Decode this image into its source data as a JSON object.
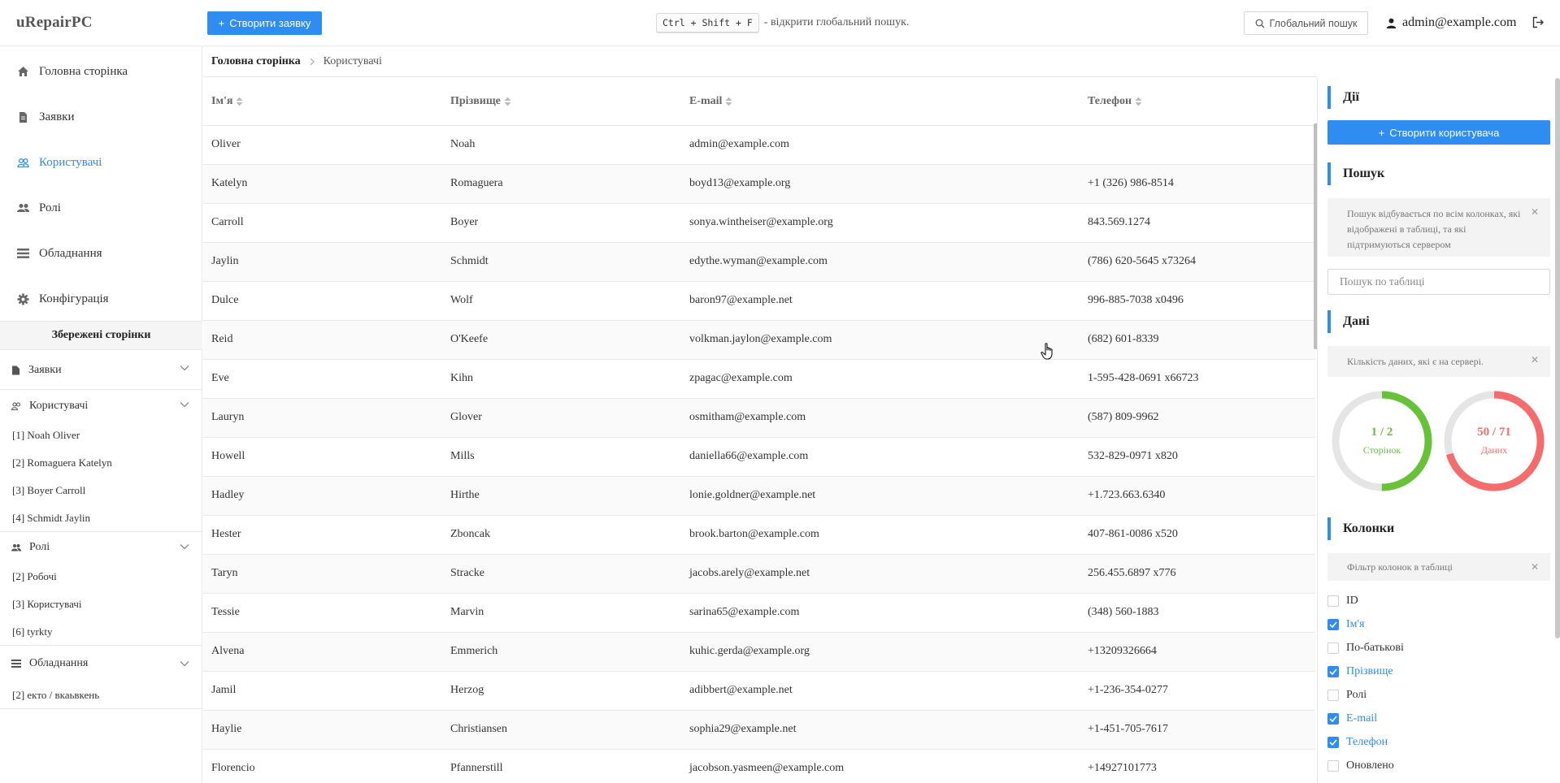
{
  "header": {
    "logo": "uRepairPC",
    "create_request_label": "Створити заявку",
    "shortcut_keys": "Ctrl + Shift + F",
    "shortcut_text": "- відкрити глобальний пошук.",
    "global_search_label": "Глобальний пошук",
    "user_email": "admin@example.com"
  },
  "nav": [
    {
      "label": "Головна сторінка",
      "icon": "home-icon"
    },
    {
      "label": "Заявки",
      "icon": "document-icon"
    },
    {
      "label": "Користувачі",
      "icon": "users-icon",
      "active": true
    },
    {
      "label": "Ролі",
      "icon": "roles-icon"
    },
    {
      "label": "Обладнання",
      "icon": "list-icon"
    },
    {
      "label": "Конфігурація",
      "icon": "gear-icon"
    }
  ],
  "saved": {
    "title": "Збережені сторінки",
    "groups": [
      {
        "label": "Заявки",
        "links": []
      },
      {
        "label": "Користувачі",
        "links": [
          "[1] Noah Oliver",
          "[2] Romaguera Katelyn",
          "[3] Boyer Carroll",
          "[4] Schmidt Jaylin"
        ]
      },
      {
        "label": "Ролі",
        "links": [
          "[2] Робочі",
          "[3] Користувачі",
          "[6] tyrkty"
        ]
      },
      {
        "label": "Обладнання",
        "links": [
          "[2] екто / вкаьвкень"
        ]
      }
    ]
  },
  "breadcrumb": {
    "home": "Головна сторінка",
    "current": "Користувачі"
  },
  "table": {
    "columns": [
      "Ім'я",
      "Прізвище",
      "E-mail",
      "Телефон"
    ],
    "rows": [
      [
        "Oliver",
        "Noah",
        "admin@example.com",
        ""
      ],
      [
        "Katelyn",
        "Romaguera",
        "boyd13@example.org",
        "+1 (326) 986-8514"
      ],
      [
        "Carroll",
        "Boyer",
        "sonya.wintheiser@example.org",
        "843.569.1274"
      ],
      [
        "Jaylin",
        "Schmidt",
        "edythe.wyman@example.com",
        "(786) 620-5645 x73264"
      ],
      [
        "Dulce",
        "Wolf",
        "baron97@example.net",
        "996-885-7038 x0496"
      ],
      [
        "Reid",
        "O'Keefe",
        "volkman.jaylon@example.com",
        "(682) 601-8339"
      ],
      [
        "Eve",
        "Kihn",
        "zpagac@example.com",
        "1-595-428-0691 x66723"
      ],
      [
        "Lauryn",
        "Glover",
        "osmitham@example.com",
        "(587) 809-9962"
      ],
      [
        "Howell",
        "Mills",
        "daniella66@example.com",
        "532-829-0971 x820"
      ],
      [
        "Hadley",
        "Hirthe",
        "lonie.goldner@example.net",
        "+1.723.663.6340"
      ],
      [
        "Hester",
        "Zboncak",
        "brook.barton@example.com",
        "407-861-0086 x520"
      ],
      [
        "Taryn",
        "Stracke",
        "jacobs.arely@example.net",
        "256.455.6897 x776"
      ],
      [
        "Tessie",
        "Marvin",
        "sarina65@example.com",
        "(348) 560-1883"
      ],
      [
        "Alvena",
        "Emmerich",
        "kuhic.gerda@example.org",
        "+13209326664"
      ],
      [
        "Jamil",
        "Herzog",
        "adibbert@example.net",
        "+1-236-354-0277"
      ],
      [
        "Haylie",
        "Christiansen",
        "sophia29@example.net",
        "+1-451-705-7617"
      ],
      [
        "Florencio",
        "Pfannerstill",
        "jacobson.yasmeen@example.com",
        "+14927101773"
      ]
    ]
  },
  "panel": {
    "actions_title": "Дії",
    "create_user_label": "Створити користувача",
    "search_title": "Пошук",
    "search_note": "Пошук відбувається по всім колонках, які відображені в таблиці, та які підтримуються сервером",
    "search_placeholder": "Пошук по таблиці",
    "data_title": "Дані",
    "data_note": "Кількість даних, які є на сервері.",
    "pages_value": "1 / 2",
    "pages_label": "Сторінок",
    "pages_fraction": 0.5,
    "pages_color": "#67c23a",
    "records_value": "50 / 71",
    "records_label": "Даних",
    "records_fraction": 0.704,
    "records_color": "#f56c6c",
    "columns_title": "Колонки",
    "columns_note": "Фільтр колонок в таблиці",
    "column_filters": [
      {
        "label": "ID",
        "checked": false
      },
      {
        "label": "Ім'я",
        "checked": true
      },
      {
        "label": "По-батькові",
        "checked": false
      },
      {
        "label": "Прізвище",
        "checked": true
      },
      {
        "label": "Ролі",
        "checked": false
      },
      {
        "label": "E-mail",
        "checked": true
      },
      {
        "label": "Телефон",
        "checked": true
      },
      {
        "label": "Оновлено",
        "checked": false
      }
    ]
  },
  "colors": {
    "accent": "#2f8cf0"
  }
}
